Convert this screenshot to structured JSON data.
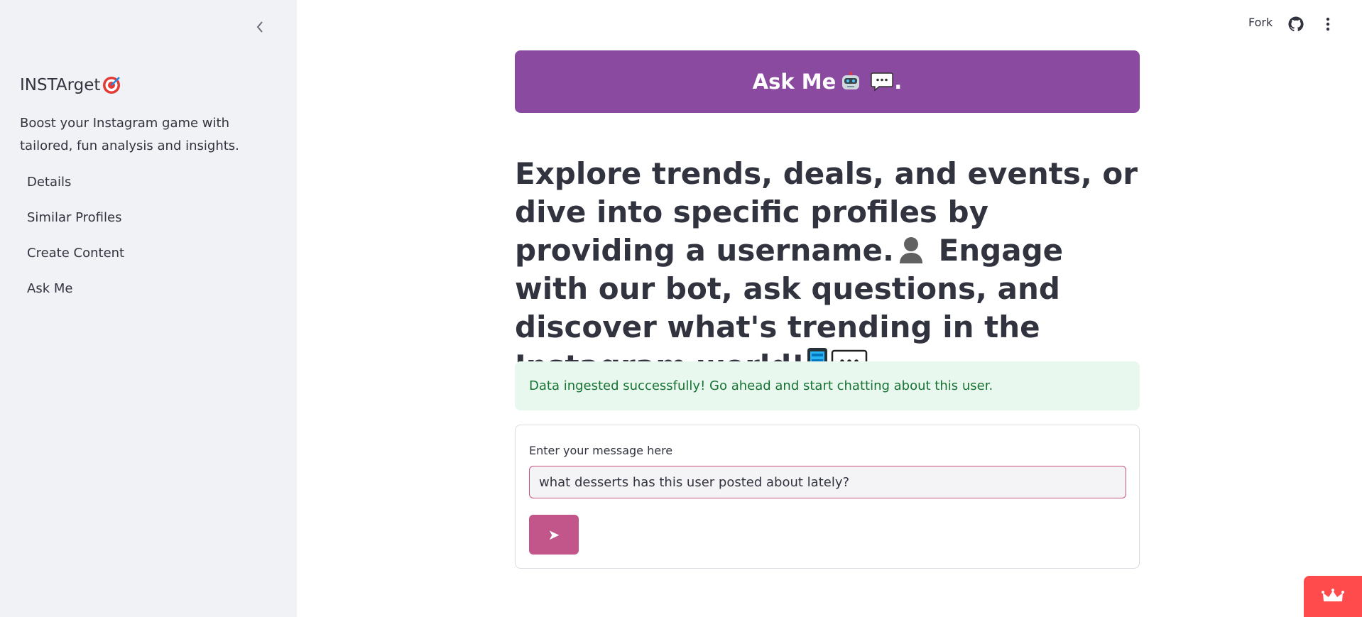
{
  "sidebar": {
    "brand": "INSTArget",
    "tagline": "Boost your Instagram game with tailored, fun analysis and insights.",
    "items": [
      {
        "label": "Details"
      },
      {
        "label": "Similar Profiles"
      },
      {
        "label": "Create Content"
      },
      {
        "label": "Ask Me"
      }
    ]
  },
  "topbar": {
    "fork_label": "Fork"
  },
  "banner": {
    "title": "Ask Me",
    "suffix": "."
  },
  "main": {
    "heading_line1": "Explore trends, deals, and events, or dive into specific profiles by providing a username.",
    "heading_line2": "Engage with our bot, ask questions, and discover what's trending in the Instagram world!",
    "success_message": "Data ingested successfully! Go ahead and start chatting about this user."
  },
  "form": {
    "label": "Enter your message here",
    "input_value": "what desserts has this user posted about lately?",
    "send_glyph": "➤"
  },
  "colors": {
    "banner": "#8a4a9f",
    "send_button": "#c2558a",
    "success_bg": "#e8f8ee",
    "success_text": "#177233",
    "badge": "#ff4b4b"
  }
}
